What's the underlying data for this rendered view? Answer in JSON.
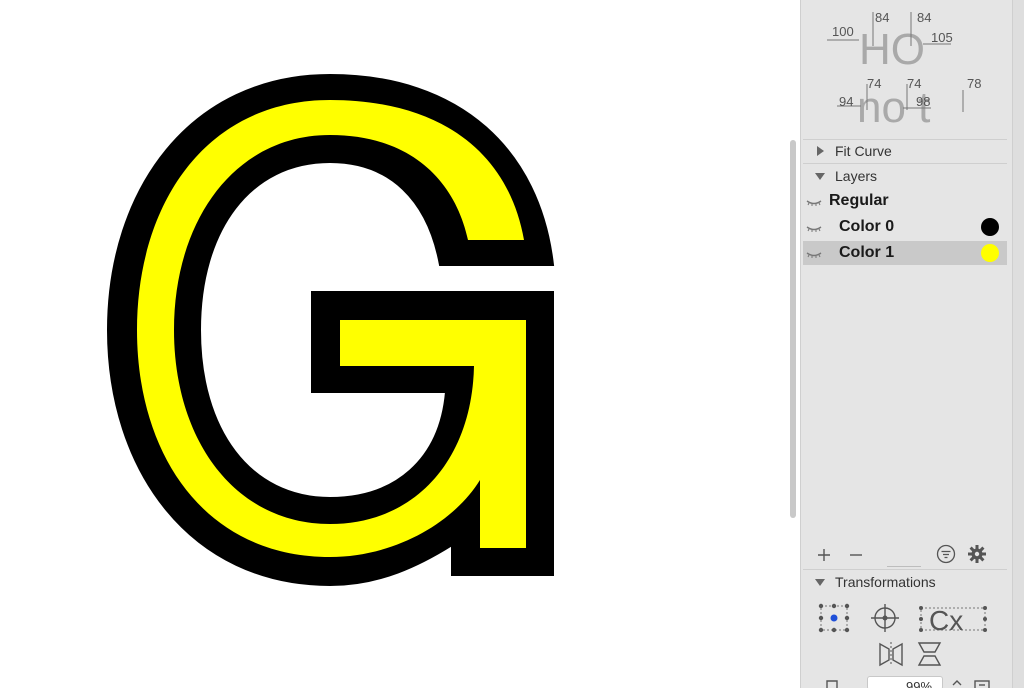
{
  "canvas": {
    "glyph": "G",
    "fill_color": "#ffff00",
    "outline_color": "#000000"
  },
  "metrics": {
    "row1": {
      "text": "HO",
      "values": [
        "100",
        "84",
        "84",
        "105"
      ]
    },
    "row2": {
      "text": "no t",
      "values": [
        "94",
        "74",
        "74",
        "98",
        "78"
      ]
    }
  },
  "sidebar": {
    "fit_curve": {
      "label": "Fit Curve"
    },
    "layers": {
      "header": "Layers",
      "items": [
        {
          "label": "Regular",
          "color": null
        },
        {
          "label": "Color 0",
          "color": "#000000"
        },
        {
          "label": "Color 1",
          "color": "#ffff00"
        }
      ]
    },
    "layer_toolbar": {
      "add_icon": "plus-icon",
      "remove_icon": "minus-icon",
      "filter_icon": "filter-icon",
      "settings_icon": "gear-icon"
    },
    "transformations": {
      "header": "Transformations",
      "tool_text": "Cx",
      "zoom_value": "99%"
    }
  },
  "colors": {
    "sidebar_bg": "#e5e5e5",
    "selected_row": "#c9c9c9",
    "separator": "#cfcfcf"
  }
}
